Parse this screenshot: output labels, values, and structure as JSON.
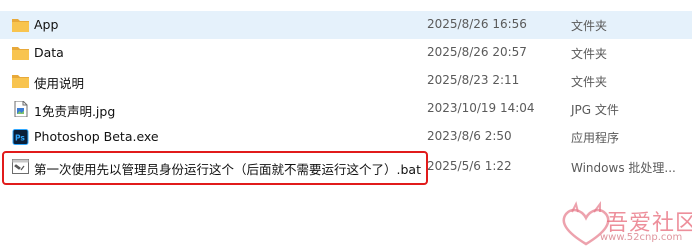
{
  "files": [
    {
      "name": "App",
      "date": "2025/8/26 16:56",
      "type": "文件夹",
      "icon": "folder-icon"
    },
    {
      "name": "Data",
      "date": "2025/8/26 20:57",
      "type": "文件夹",
      "icon": "folder-icon"
    },
    {
      "name": "使用说明",
      "date": "2025/8/23 2:11",
      "type": "文件夹",
      "icon": "folder-icon"
    },
    {
      "name": "1免责声明.jpg",
      "date": "2023/10/19 14:04",
      "type": "JPG 文件",
      "icon": "image-file-icon"
    },
    {
      "name": "Photoshop Beta.exe",
      "date": "2023/8/6 2:50",
      "type": "应用程序",
      "icon": "photoshop-icon"
    },
    {
      "name": "第一次使用先以管理员身份运行这个（后面就不需要运行这个了）.bat",
      "date": "2025/5/6 1:22",
      "type": "Windows 批处理...",
      "icon": "batch-file-icon"
    }
  ],
  "watermark": {
    "title": "吾爱社区",
    "url": "www.52cnp.com"
  },
  "colors": {
    "highlight_border": "#e11b1b",
    "selected_row": "#e5f1fb",
    "folder": "#f8c44f",
    "photoshop": "#31a8ff"
  }
}
